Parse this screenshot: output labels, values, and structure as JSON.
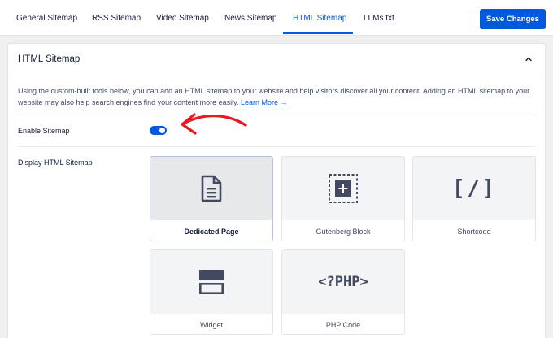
{
  "tabs": [
    {
      "label": "General Sitemap"
    },
    {
      "label": "RSS Sitemap"
    },
    {
      "label": "Video Sitemap"
    },
    {
      "label": "News Sitemap"
    },
    {
      "label": "HTML Sitemap",
      "active": true
    },
    {
      "label": "LLMs.txt"
    }
  ],
  "save_button": "Save Changes",
  "card": {
    "title": "HTML Sitemap",
    "description": "Using the custom-built tools below, you can add an HTML sitemap to your website and help visitors discover all your content. Adding an HTML sitemap to your website may also help search engines find your content more easily.",
    "learn_more": "Learn More →"
  },
  "enable_sitemap": {
    "label": "Enable Sitemap",
    "enabled": true
  },
  "display": {
    "label": "Display HTML Sitemap",
    "options": [
      {
        "label": "Dedicated Page",
        "icon": "document-icon",
        "selected": true
      },
      {
        "label": "Gutenberg Block",
        "icon": "block-plus-icon"
      },
      {
        "label": "Shortcode",
        "icon": "shortcode-icon",
        "glyph": "[/]"
      },
      {
        "label": "Widget",
        "icon": "widget-icon"
      },
      {
        "label": "PHP Code",
        "icon": "php-code-icon",
        "glyph": "<?PHP>"
      }
    ]
  },
  "colors": {
    "accent": "#005ae0",
    "annotation_arrow": "#e8191f"
  }
}
